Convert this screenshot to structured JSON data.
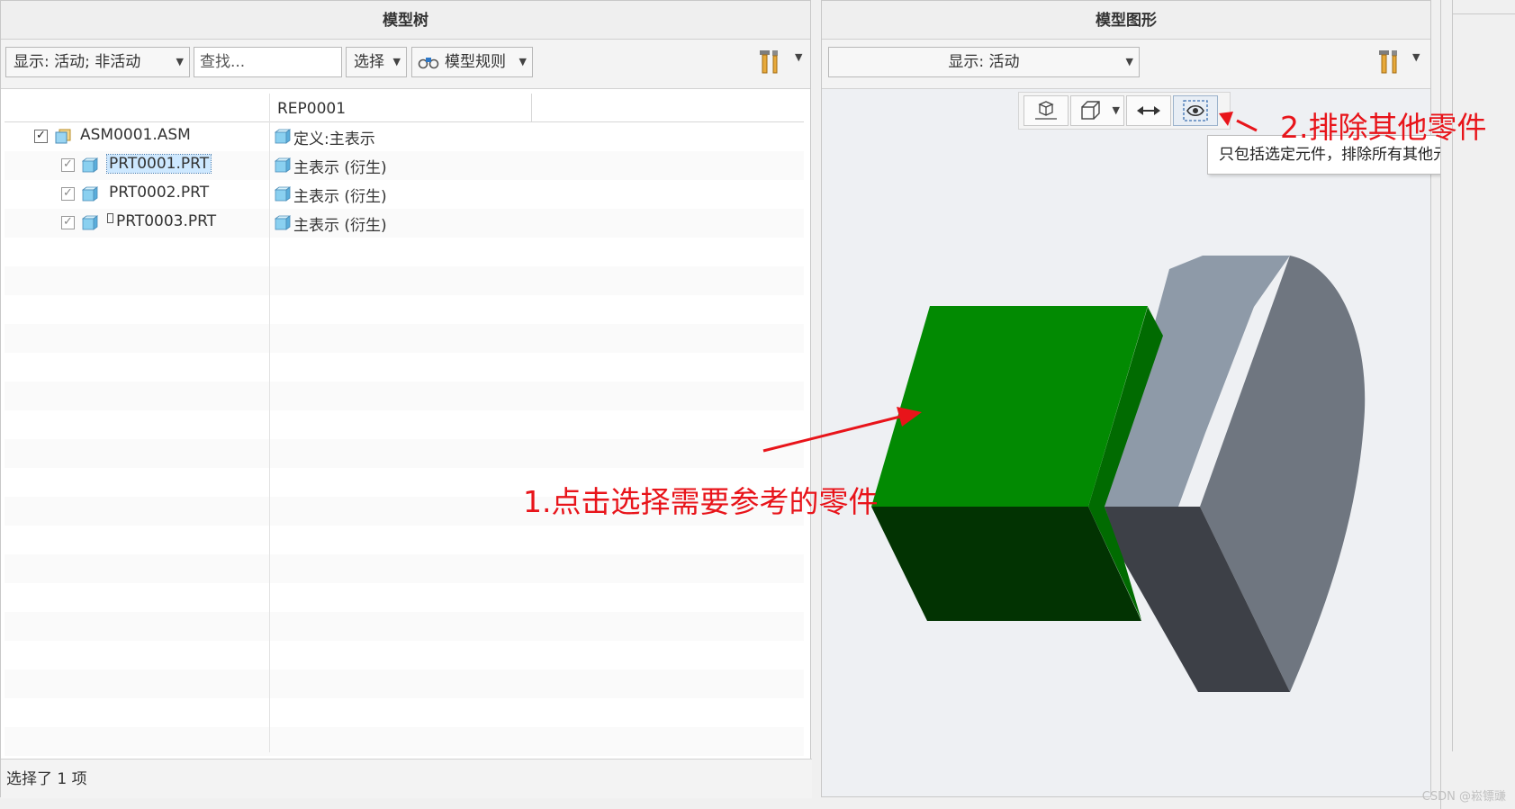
{
  "left_panel": {
    "title": "模型树",
    "display_combo": "显示: 活动; 非活动",
    "search_placeholder": "查找...",
    "select_combo": "选择",
    "rules_button": "模型规则",
    "column_header": "REP0001",
    "rows": [
      {
        "name": "ASM0001.ASM",
        "rep": "定义:主表示",
        "checked": true,
        "selected": false
      },
      {
        "name": "PRT0001.PRT",
        "rep": "主表示 (衍生)",
        "checked": true,
        "selected": true
      },
      {
        "name": "PRT0002.PRT",
        "rep": "主表示 (衍生)",
        "checked": true,
        "selected": false
      },
      {
        "name": "PRT0003.PRT",
        "rep": "主表示 (衍生)",
        "checked": true,
        "selected": false
      }
    ],
    "status": "选择了 1 项"
  },
  "right_panel": {
    "title": "模型图形",
    "display_combo": "显示: 活动",
    "tooltip": "只包括选定元件，排除所有其他元件。"
  },
  "annotations": {
    "step1": "1.点击选择需要参考的零件",
    "step2": "2.排除其他零件"
  },
  "watermark": "CSDN @崧镖豏",
  "colors": {
    "annotation_red": "#e8141a",
    "green_front": "#028a02",
    "green_bottom": "#023302",
    "green_side": "#016b01",
    "grey_top": "#8e9aa8",
    "grey_face": "#6f7680",
    "grey_bottom": "#3d4047",
    "selection_blue": "#cde8ff"
  }
}
